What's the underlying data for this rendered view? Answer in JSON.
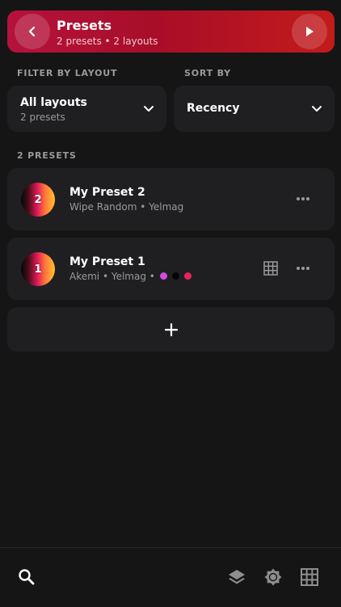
{
  "header": {
    "title": "Presets",
    "subtitle": "2 presets • 2 layouts",
    "back_icon": "chevron-left-icon",
    "play_icon": "play-icon",
    "gradient": [
      "#b5123c",
      "#c21b1b"
    ]
  },
  "filters": {
    "layout_label": "FILTER BY LAYOUT",
    "layout_value": "All layouts",
    "layout_count": "2 presets",
    "sort_label": "SORT BY",
    "sort_value": "Recency"
  },
  "presets": {
    "count_label": "2 PRESETS",
    "items": [
      {
        "number": "2",
        "name": "My Preset 2",
        "details": "Wipe Random • Yelmag"
      },
      {
        "number": "1",
        "name": "My Preset 1",
        "details": "Akemi • Yelmag •",
        "colors": [
          "#d24ce0",
          "#050505",
          "#e8245a"
        ]
      }
    ]
  },
  "add_button": {
    "icon": "plus-icon"
  },
  "bottom_nav": {
    "items": [
      {
        "name": "search",
        "icon": "search-icon"
      },
      {
        "name": "layers",
        "icon": "layers-icon"
      },
      {
        "name": "brightness",
        "icon": "brightness-icon"
      },
      {
        "name": "grid",
        "icon": "grid-icon"
      }
    ]
  },
  "colors": {
    "background": "#151515",
    "card": "#1f1f21",
    "muted_text": "#9a9a9a"
  }
}
